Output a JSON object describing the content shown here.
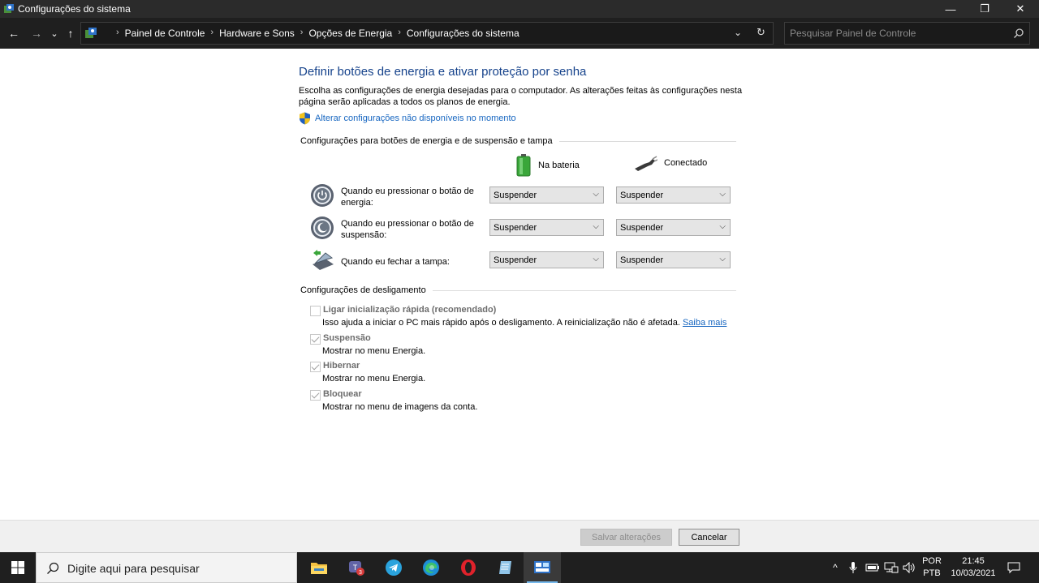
{
  "window": {
    "title": "Configurações do sistema",
    "controls": {
      "minimize": "—",
      "restore": "❐",
      "close": "✕"
    }
  },
  "nav": {
    "back": "←",
    "forward": "→",
    "recent": "⌄",
    "up": "↑",
    "breadcrumbs": [
      "Painel de Controle",
      "Hardware e Sons",
      "Opções de Energia",
      "Configurações do sistema"
    ],
    "separator": "›",
    "dropdown": "⌄",
    "refresh": "↻",
    "search_placeholder": "Pesquisar Painel de Controle"
  },
  "page": {
    "heading": "Definir botões de energia e ativar proteção por senha",
    "description": "Escolha as configurações de energia desejadas para o computador. As alterações feitas às configurações nesta página serão aplicadas a todos os planos de energia.",
    "change_link": "Alterar configurações não disponíveis no momento",
    "section_buttons": "Configurações para botões de energia e de suspensão e tampa",
    "col_battery": "Na bateria",
    "col_plugged": "Conectado",
    "rows": [
      {
        "label": "Quando eu pressionar o botão de energia:",
        "battery": "Suspender",
        "plugged": "Suspender"
      },
      {
        "label": "Quando eu pressionar o botão de suspensão:",
        "battery": "Suspender",
        "plugged": "Suspender"
      },
      {
        "label": "Quando eu fechar a tampa:",
        "battery": "Suspender",
        "plugged": "Suspender"
      }
    ],
    "section_shutdown": "Configurações de desligamento",
    "shutdown_options": [
      {
        "label": "Ligar inicialização rápida (recomendado)",
        "desc": "Isso ajuda a iniciar o PC mais rápido após o desligamento. A reinicialização não é afetada.",
        "link": "Saiba mais",
        "checked": false
      },
      {
        "label": "Suspensão",
        "desc": "Mostrar no menu Energia.",
        "checked": true
      },
      {
        "label": "Hibernar",
        "desc": "Mostrar no menu Energia.",
        "checked": true
      },
      {
        "label": "Bloquear",
        "desc": "Mostrar no menu de imagens da conta.",
        "checked": true
      }
    ],
    "save_label": "Salvar alterações",
    "cancel_label": "Cancelar"
  },
  "taskbar": {
    "search_placeholder": "Digite aqui para pesquisar",
    "apps": [
      "file-explorer",
      "teams",
      "telegram",
      "edge",
      "opera",
      "notepad",
      "control-panel"
    ],
    "teams_badge": "3",
    "language": "POR",
    "layout": "PTB",
    "time": "21:45",
    "date": "10/03/2021",
    "tray_chevron": "^"
  },
  "colors": {
    "accent": "#15428b",
    "link": "#1565c0",
    "titlebar": "#2b2b2b",
    "taskbar": "#1f1f1f"
  }
}
